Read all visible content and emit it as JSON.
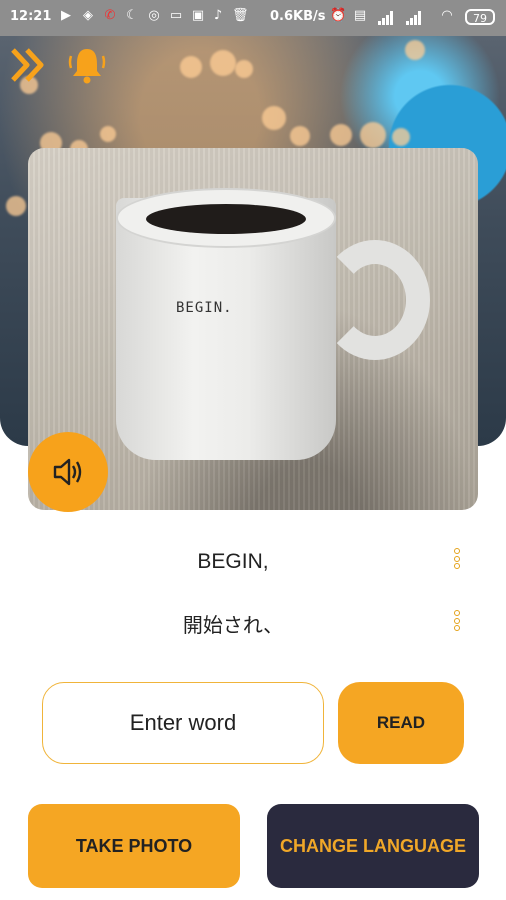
{
  "status_bar": {
    "time": "12:21",
    "net_speed": "0.6KB/s",
    "battery": "79"
  },
  "header": {
    "expand_icon": "double-chevron-right-icon",
    "bell_icon": "bell-icon"
  },
  "photo": {
    "mug_text": "BEGIN."
  },
  "results": {
    "recognized_text": "BEGIN,",
    "translated_text": "開始され、"
  },
  "input": {
    "placeholder": "Enter word",
    "value": ""
  },
  "buttons": {
    "read": "READ",
    "take_photo": "TAKE PHOTO",
    "change_language": "CHANGE LANGUAGE"
  },
  "colors": {
    "accent": "#f5a623",
    "dark_button": "#2a2a3e",
    "status_bar": "#8e8e8e"
  }
}
